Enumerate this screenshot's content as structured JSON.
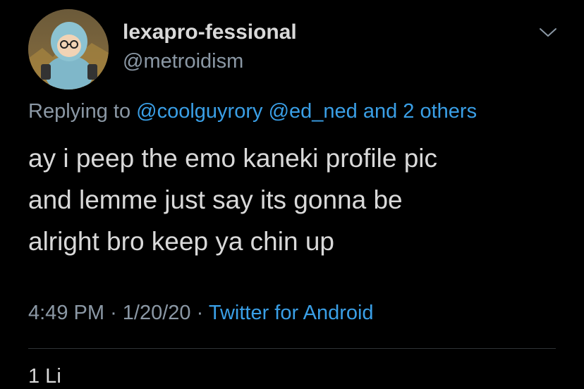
{
  "user": {
    "display_name": "lexapro-fessional",
    "handle": "@metroidism",
    "avatar_icon": "avatar-image"
  },
  "reply": {
    "prefix": "Replying to",
    "mention_1": "@coolguyrory",
    "mention_2": "@ed_ned",
    "others": "and 2 others"
  },
  "body": {
    "lines": [
      "ay i peep the emo kaneki profile pic",
      "and lemme just say its gonna be",
      "alright bro keep ya chin up"
    ]
  },
  "meta": {
    "time": "4:49 PM",
    "separator": "·",
    "date": "1/20/20",
    "source": "Twitter for Android"
  },
  "stats": {
    "peek": "1 Li"
  },
  "menu": {
    "icon": "chevron-down-icon"
  },
  "colors": {
    "background": "#000000",
    "text": "#d9d9d9",
    "secondary": "#8b98a5",
    "link": "#3a9fe6"
  }
}
